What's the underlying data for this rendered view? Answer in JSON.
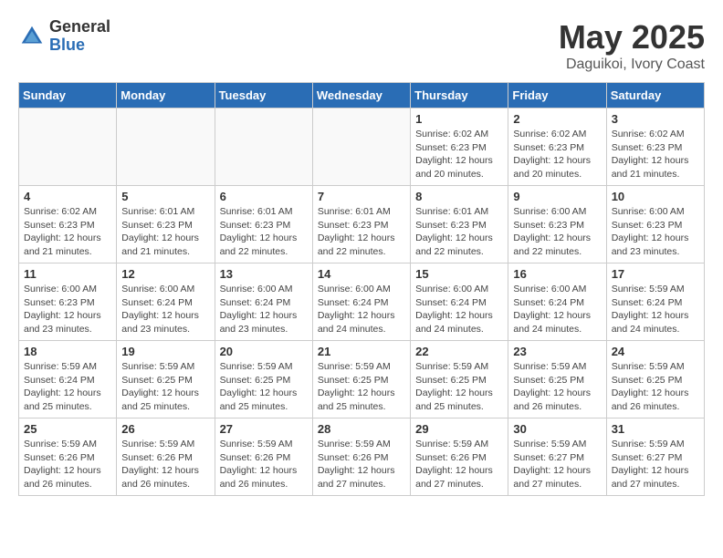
{
  "header": {
    "logo": {
      "general": "General",
      "blue": "Blue"
    },
    "title": "May 2025",
    "location": "Daguikoi, Ivory Coast"
  },
  "weekdays": [
    "Sunday",
    "Monday",
    "Tuesday",
    "Wednesday",
    "Thursday",
    "Friday",
    "Saturday"
  ],
  "weeks": [
    [
      {
        "day": "",
        "info": ""
      },
      {
        "day": "",
        "info": ""
      },
      {
        "day": "",
        "info": ""
      },
      {
        "day": "",
        "info": ""
      },
      {
        "day": "1",
        "info": "Sunrise: 6:02 AM\nSunset: 6:23 PM\nDaylight: 12 hours\nand 20 minutes."
      },
      {
        "day": "2",
        "info": "Sunrise: 6:02 AM\nSunset: 6:23 PM\nDaylight: 12 hours\nand 20 minutes."
      },
      {
        "day": "3",
        "info": "Sunrise: 6:02 AM\nSunset: 6:23 PM\nDaylight: 12 hours\nand 21 minutes."
      }
    ],
    [
      {
        "day": "4",
        "info": "Sunrise: 6:02 AM\nSunset: 6:23 PM\nDaylight: 12 hours\nand 21 minutes."
      },
      {
        "day": "5",
        "info": "Sunrise: 6:01 AM\nSunset: 6:23 PM\nDaylight: 12 hours\nand 21 minutes."
      },
      {
        "day": "6",
        "info": "Sunrise: 6:01 AM\nSunset: 6:23 PM\nDaylight: 12 hours\nand 22 minutes."
      },
      {
        "day": "7",
        "info": "Sunrise: 6:01 AM\nSunset: 6:23 PM\nDaylight: 12 hours\nand 22 minutes."
      },
      {
        "day": "8",
        "info": "Sunrise: 6:01 AM\nSunset: 6:23 PM\nDaylight: 12 hours\nand 22 minutes."
      },
      {
        "day": "9",
        "info": "Sunrise: 6:00 AM\nSunset: 6:23 PM\nDaylight: 12 hours\nand 22 minutes."
      },
      {
        "day": "10",
        "info": "Sunrise: 6:00 AM\nSunset: 6:23 PM\nDaylight: 12 hours\nand 23 minutes."
      }
    ],
    [
      {
        "day": "11",
        "info": "Sunrise: 6:00 AM\nSunset: 6:23 PM\nDaylight: 12 hours\nand 23 minutes."
      },
      {
        "day": "12",
        "info": "Sunrise: 6:00 AM\nSunset: 6:24 PM\nDaylight: 12 hours\nand 23 minutes."
      },
      {
        "day": "13",
        "info": "Sunrise: 6:00 AM\nSunset: 6:24 PM\nDaylight: 12 hours\nand 23 minutes."
      },
      {
        "day": "14",
        "info": "Sunrise: 6:00 AM\nSunset: 6:24 PM\nDaylight: 12 hours\nand 24 minutes."
      },
      {
        "day": "15",
        "info": "Sunrise: 6:00 AM\nSunset: 6:24 PM\nDaylight: 12 hours\nand 24 minutes."
      },
      {
        "day": "16",
        "info": "Sunrise: 6:00 AM\nSunset: 6:24 PM\nDaylight: 12 hours\nand 24 minutes."
      },
      {
        "day": "17",
        "info": "Sunrise: 5:59 AM\nSunset: 6:24 PM\nDaylight: 12 hours\nand 24 minutes."
      }
    ],
    [
      {
        "day": "18",
        "info": "Sunrise: 5:59 AM\nSunset: 6:24 PM\nDaylight: 12 hours\nand 25 minutes."
      },
      {
        "day": "19",
        "info": "Sunrise: 5:59 AM\nSunset: 6:25 PM\nDaylight: 12 hours\nand 25 minutes."
      },
      {
        "day": "20",
        "info": "Sunrise: 5:59 AM\nSunset: 6:25 PM\nDaylight: 12 hours\nand 25 minutes."
      },
      {
        "day": "21",
        "info": "Sunrise: 5:59 AM\nSunset: 6:25 PM\nDaylight: 12 hours\nand 25 minutes."
      },
      {
        "day": "22",
        "info": "Sunrise: 5:59 AM\nSunset: 6:25 PM\nDaylight: 12 hours\nand 25 minutes."
      },
      {
        "day": "23",
        "info": "Sunrise: 5:59 AM\nSunset: 6:25 PM\nDaylight: 12 hours\nand 26 minutes."
      },
      {
        "day": "24",
        "info": "Sunrise: 5:59 AM\nSunset: 6:25 PM\nDaylight: 12 hours\nand 26 minutes."
      }
    ],
    [
      {
        "day": "25",
        "info": "Sunrise: 5:59 AM\nSunset: 6:26 PM\nDaylight: 12 hours\nand 26 minutes."
      },
      {
        "day": "26",
        "info": "Sunrise: 5:59 AM\nSunset: 6:26 PM\nDaylight: 12 hours\nand 26 minutes."
      },
      {
        "day": "27",
        "info": "Sunrise: 5:59 AM\nSunset: 6:26 PM\nDaylight: 12 hours\nand 26 minutes."
      },
      {
        "day": "28",
        "info": "Sunrise: 5:59 AM\nSunset: 6:26 PM\nDaylight: 12 hours\nand 27 minutes."
      },
      {
        "day": "29",
        "info": "Sunrise: 5:59 AM\nSunset: 6:26 PM\nDaylight: 12 hours\nand 27 minutes."
      },
      {
        "day": "30",
        "info": "Sunrise: 5:59 AM\nSunset: 6:27 PM\nDaylight: 12 hours\nand 27 minutes."
      },
      {
        "day": "31",
        "info": "Sunrise: 5:59 AM\nSunset: 6:27 PM\nDaylight: 12 hours\nand 27 minutes."
      }
    ]
  ]
}
